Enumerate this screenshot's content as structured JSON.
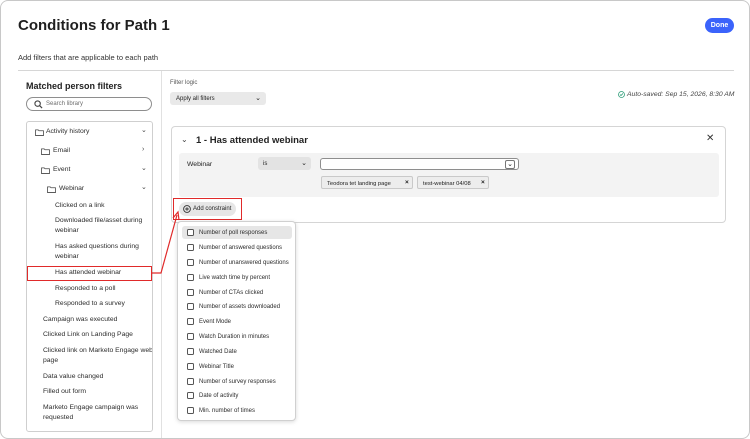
{
  "dialog": {
    "title": "Conditions for Path 1",
    "subtitle": "Add filters that are applicable to each path",
    "done_label": "Done"
  },
  "colors": {
    "accent": "#3b63fb",
    "highlight": "#e02a2a",
    "success": "#2d9d78"
  },
  "left_panel": {
    "title": "Matched person filters",
    "search_placeholder": "Search library",
    "tree": [
      {
        "label": "Activity history",
        "type": "folder",
        "expanded": true
      },
      {
        "label": "Email",
        "type": "folder",
        "expanded": false
      },
      {
        "label": "Event",
        "type": "folder",
        "expanded": true
      },
      {
        "label": "Webinar",
        "type": "folder",
        "expanded": true
      },
      {
        "label": "Clicked on a link",
        "type": "item"
      },
      {
        "label": "Downloaded file/asset during webinar",
        "type": "item"
      },
      {
        "label": "Has asked questions during webinar",
        "type": "item"
      },
      {
        "label": "Has attended webinar",
        "type": "item",
        "selected": true
      },
      {
        "label": "Responded to a poll",
        "type": "item"
      },
      {
        "label": "Responded to a survey",
        "type": "item"
      },
      {
        "label": "Campaign was executed",
        "type": "item"
      },
      {
        "label": "Clicked Link on Landing Page",
        "type": "item"
      },
      {
        "label": "Clicked link on Marketo Engage web page",
        "type": "item"
      },
      {
        "label": "Data value changed",
        "type": "item"
      },
      {
        "label": "Filled out form",
        "type": "item"
      },
      {
        "label": "Marketo Engage campaign was requested",
        "type": "item"
      }
    ]
  },
  "filter_logic": {
    "label": "Filter logic",
    "value": "Apply all filters"
  },
  "autosaved": "Auto-saved: Sep 15, 2026, 8:30 AM",
  "condition": {
    "title": "1 - Has attended webinar",
    "field": "Webinar",
    "operator": "is",
    "value": "",
    "tags": [
      "Teodora tet landing page",
      "test-webinar 04/08"
    ],
    "add_constraint_label": "Add constraint"
  },
  "constraint_menu": [
    "Number of poll responses",
    "Number of answered questions",
    "Number of unanswered questions",
    "Live watch time by percent",
    "Number of CTAs clicked",
    "Number of assets downloaded",
    "Event Mode",
    "Watch Duration in minutes",
    "Watched Date",
    "Webinar Title",
    "Number of survey responses",
    "Date of activity",
    "Min. number of times"
  ]
}
